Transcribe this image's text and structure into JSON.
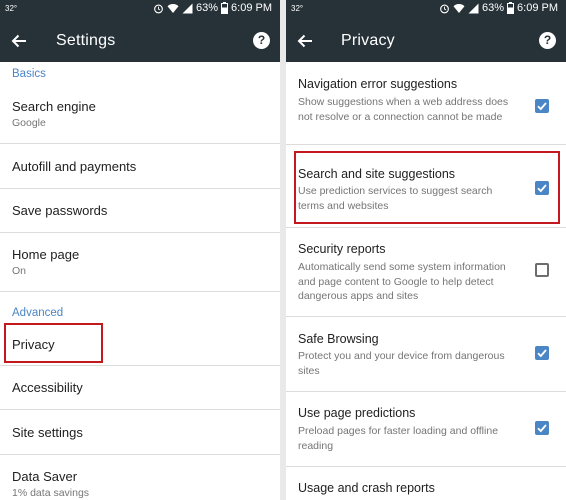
{
  "status_bar": {
    "temperature": "32°",
    "battery": "63%",
    "time": "6:09 PM"
  },
  "settings": {
    "title": "Settings",
    "sections": {
      "basics": "Basics",
      "advanced": "Advanced"
    },
    "items": [
      {
        "label": "Search engine",
        "sub": "Google"
      },
      {
        "label": "Autofill and payments"
      },
      {
        "label": "Save passwords"
      },
      {
        "label": "Home page",
        "sub": "On"
      },
      {
        "label": "Privacy"
      },
      {
        "label": "Accessibility"
      },
      {
        "label": "Site settings"
      },
      {
        "label": "Data Saver",
        "sub": "1% data savings"
      }
    ]
  },
  "privacy": {
    "title": "Privacy",
    "items": [
      {
        "label": "Navigation error suggestions",
        "desc": "Show suggestions when a web address does not resolve or a connection cannot be made",
        "checked": true
      },
      {
        "label": "Search and site suggestions",
        "desc": "Use prediction services to suggest search terms and websites",
        "checked": true
      },
      {
        "label": "Security reports",
        "desc": "Automatically send some system information and page content to Google to help detect dangerous apps and sites",
        "checked": false
      },
      {
        "label": "Safe Browsing",
        "desc": "Protect you and your device from dangerous sites",
        "checked": true
      },
      {
        "label": "Use page predictions",
        "desc": "Preload pages for faster loading and offline reading",
        "checked": true
      },
      {
        "label": "Usage and crash reports"
      }
    ]
  },
  "colors": {
    "app_bar": "#263238",
    "accent": "#4a86c5",
    "highlight": "#c4181f"
  },
  "icons": {
    "back": "arrow-back-icon",
    "help": "help-icon"
  }
}
